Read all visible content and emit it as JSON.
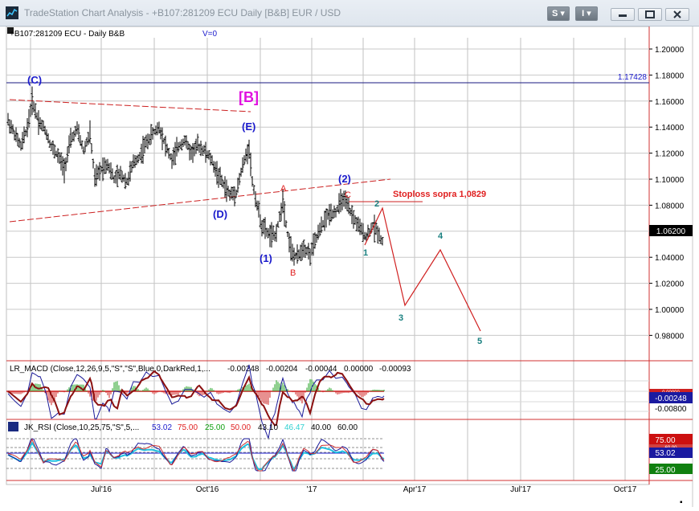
{
  "window": {
    "title": "TradeStation Chart Analysis  -  +B107:281209 ECU Daily [B&B] EUR / USD",
    "s_button": "S",
    "i_button": "I"
  },
  "symbol_header": {
    "symbol_label": "+B107:281209 ECU - Daily  B&B",
    "volume_label": "V=0"
  },
  "price_axis": {
    "ticks": [
      "1.20000",
      "1.18000",
      "1.16000",
      "1.14000",
      "1.12000",
      "1.10000",
      "1.08000",
      "1.06000",
      "1.04000",
      "1.02000",
      "1.00000",
      "0.98000"
    ],
    "last_price": "1.06200",
    "ref_line_label": "1.17428"
  },
  "time_axis": {
    "labels": [
      "Jul'16",
      "Oct'16",
      "'17",
      "Apr'17",
      "Jul'17",
      "Oct'17"
    ]
  },
  "wave_labels": {
    "C_major": "(C)",
    "B_bracket": "[B]",
    "E": "(E)",
    "D": "(D)",
    "one_paren": "(1)",
    "two_paren": "(2)",
    "A": "A",
    "B": "B",
    "C": "C",
    "w1": "1",
    "w2": "2",
    "w3": "3",
    "w4": "4",
    "w5": "5",
    "stoploss": "Stoploss sopra 1,0829"
  },
  "macd": {
    "label": "LR_MACD (Close,12,26,9,5,\"S\",\"S\",Blue,0,DarkRed,1,...",
    "v1": "-0.00248",
    "v2": "-0.00204",
    "v3": "-0.00044",
    "v4": "0.00000",
    "v5": "-0.00093",
    "axis_tag": "-0.00248",
    "axis_tick": "-0.00800",
    "axis_tag_red": "0.00000"
  },
  "rsi": {
    "label": "JK_RSI (Close,10,25,75,\"S\",5,...",
    "v1": "53.02",
    "v2": "75.00",
    "v3": "25.00",
    "v4": "50.00",
    "v5": "43.10",
    "v6": "46.47",
    "v7": "40.00",
    "v8": "60.00",
    "tag_75": "75.00",
    "tag_60": "60.00",
    "tag_53": "53.02",
    "tag_25": "25.00"
  },
  "colors": {
    "wave_blue": "#1a1acc",
    "wave_red": "#e02020",
    "wave_teal": "#1a8080",
    "magenta": "#e010e0",
    "price_bars": "#000000"
  }
}
